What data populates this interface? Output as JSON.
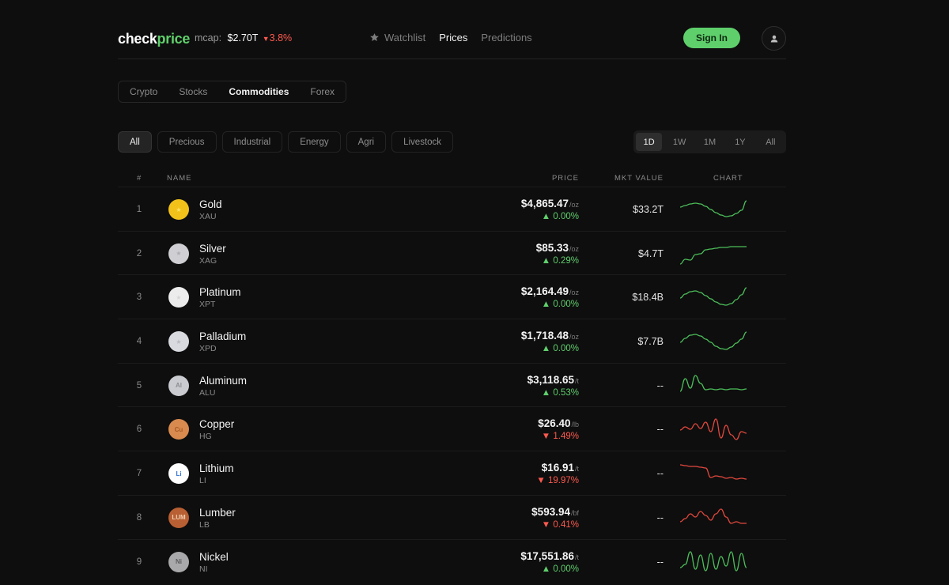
{
  "header": {
    "logo_main": "check",
    "logo_accent": "price",
    "mcap_label": "mcap:",
    "mcap_value": "$2.70T",
    "mcap_change": "3.8%",
    "nav": [
      {
        "label": "Watchlist",
        "icon": "star-icon"
      },
      {
        "label": "Prices"
      },
      {
        "label": "Predictions"
      }
    ],
    "signin_label": "Sign In"
  },
  "market_tabs": [
    "Crypto",
    "Stocks",
    "Commodities",
    "Forex"
  ],
  "active_market_tab": "Commodities",
  "filters": [
    "All",
    "Precious",
    "Industrial",
    "Energy",
    "Agri",
    "Livestock"
  ],
  "active_filter": "All",
  "periods": [
    "1D",
    "1W",
    "1M",
    "1Y",
    "All"
  ],
  "active_period": "1D",
  "table": {
    "columns": {
      "rank": "#",
      "name": "NAME",
      "price": "PRICE",
      "mkt": "MKT VALUE",
      "chart": "CHART"
    },
    "rows": [
      {
        "rank": "1",
        "name": "Gold",
        "symbol": "XAU",
        "price": "$4,865.47",
        "unit": "/oz",
        "change": "0.00%",
        "dir": "up",
        "mkt": "$33.2T",
        "icon_bg": "#f2c21a",
        "icon_fg": "#ffe36b",
        "icon_text": "★",
        "spark_color": "#4cbe5a",
        "spark": [
          14,
          12,
          10,
          9,
          10,
          13,
          17,
          21,
          24,
          26,
          25,
          22,
          18,
          6
        ]
      },
      {
        "rank": "2",
        "name": "Silver",
        "symbol": "XAG",
        "price": "$85.33",
        "unit": "/oz",
        "change": "0.29%",
        "dir": "up",
        "mkt": "$4.7T",
        "icon_bg": "#cfcfd3",
        "icon_fg": "#aeaeb3",
        "icon_text": "★",
        "spark_color": "#4cbe5a",
        "spark": [
          30,
          24,
          25,
          18,
          17,
          12,
          11,
          10,
          9,
          9,
          8,
          8,
          8,
          8
        ]
      },
      {
        "rank": "3",
        "name": "Platinum",
        "symbol": "XPT",
        "price": "$2,164.49",
        "unit": "/oz",
        "change": "0.00%",
        "dir": "up",
        "mkt": "$18.4B",
        "icon_bg": "#ececec",
        "icon_fg": "#d6d6d6",
        "icon_text": "★",
        "spark_color": "#4cbe5a",
        "spark": [
          18,
          13,
          10,
          9,
          11,
          15,
          19,
          23,
          26,
          27,
          25,
          20,
          14,
          5
        ]
      },
      {
        "rank": "4",
        "name": "Palladium",
        "symbol": "XPD",
        "price": "$1,718.48",
        "unit": "/oz",
        "change": "0.00%",
        "dir": "up",
        "mkt": "$7.7B",
        "icon_bg": "#d8dadf",
        "icon_fg": "#b7bac1",
        "icon_text": "★",
        "spark_color": "#4cbe5a",
        "spark": [
          18,
          13,
          9,
          8,
          10,
          14,
          18,
          23,
          26,
          27,
          24,
          19,
          14,
          5
        ]
      },
      {
        "rank": "5",
        "name": "Aluminum",
        "symbol": "ALU",
        "price": "$3,118.65",
        "unit": "/t",
        "change": "0.53%",
        "dir": "up",
        "mkt": "--",
        "icon_bg": "#c9cbd0",
        "icon_fg": "#8b8d93",
        "icon_text": "Al",
        "spark_color": "#4cbe5a",
        "spark": [
          24,
          8,
          20,
          4,
          14,
          22,
          21,
          22,
          21,
          22,
          21,
          21,
          22,
          21
        ]
      },
      {
        "rank": "6",
        "name": "Copper",
        "symbol": "HG",
        "price": "$26.40",
        "unit": "/lb",
        "change": "1.49%",
        "dir": "down",
        "mkt": "--",
        "icon_bg": "#d98a4e",
        "icon_fg": "#a85c28",
        "icon_text": "Cu",
        "spark_color": "#e2483e",
        "spark": [
          18,
          14,
          17,
          10,
          16,
          8,
          20,
          4,
          28,
          12,
          24,
          30,
          20,
          22
        ]
      },
      {
        "rank": "7",
        "name": "Lithium",
        "symbol": "LI",
        "price": "$16.91",
        "unit": "/t",
        "change": "19.97%",
        "dir": "down",
        "mkt": "--",
        "icon_bg": "#ffffff",
        "icon_fg": "#2f6fd6",
        "icon_text": "Li",
        "spark_color": "#e2483e",
        "spark": [
          6,
          7,
          8,
          8,
          9,
          10,
          22,
          20,
          21,
          23,
          22,
          24,
          23,
          24
        ]
      },
      {
        "rank": "8",
        "name": "Lumber",
        "symbol": "LB",
        "price": "$593.94",
        "unit": "/bf",
        "change": "0.41%",
        "dir": "down",
        "mkt": "--",
        "icon_bg": "#b85f33",
        "icon_fg": "#f3d1b3",
        "icon_text": "LUM",
        "spark_color": "#e2483e",
        "spark": [
          22,
          18,
          12,
          16,
          9,
          14,
          20,
          12,
          6,
          16,
          24,
          22,
          24,
          24
        ]
      },
      {
        "rank": "9",
        "name": "Nickel",
        "symbol": "NI",
        "price": "$17,551.86",
        "unit": "/t",
        "change": "0.00%",
        "dir": "up",
        "mkt": "--",
        "icon_bg": "#a9a9ab",
        "icon_fg": "#5c5c60",
        "icon_text": "Ni",
        "spark_color": "#4cbe5a",
        "spark": [
          24,
          20,
          4,
          26,
          8,
          28,
          6,
          26,
          10,
          22,
          4,
          28,
          6,
          24
        ]
      }
    ]
  }
}
